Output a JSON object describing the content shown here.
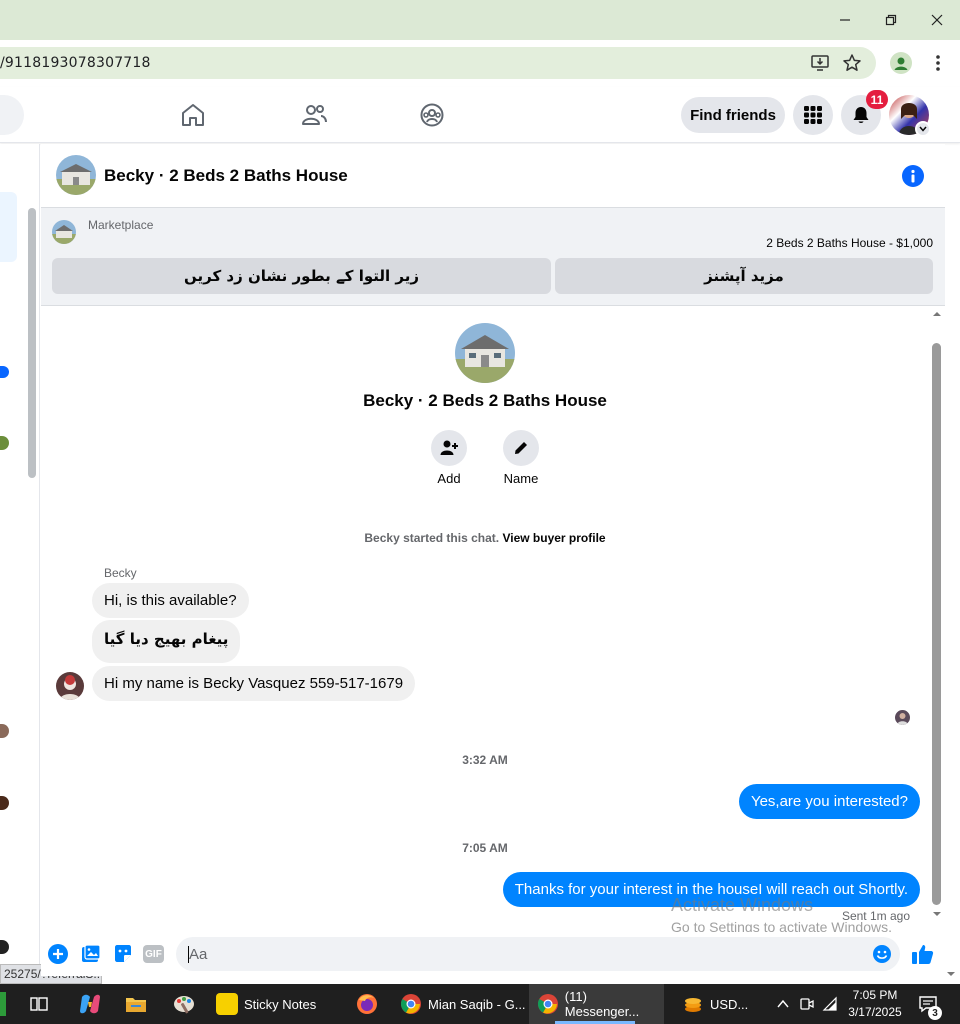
{
  "browser": {
    "url_fragment": "/9118193078307718",
    "status_url": "25275/?referralS..."
  },
  "header": {
    "find_friends_label": "Find friends",
    "notification_count": "11"
  },
  "chat": {
    "title": "Becky · 2 Beds 2 Baths House",
    "marketplace_label": "Marketplace",
    "listing": "2 Beds 2 Baths House - $1,000",
    "mark_sold_label": "زیر التوا کے بطور نشان زد کریں",
    "more_options_label": "مزید آپشنز",
    "profile_title": "Becky · 2 Beds 2 Baths House",
    "add_label": "Add",
    "name_label": "Name",
    "started_text": "Becky started this chat.",
    "view_profile_link": "View buyer profile",
    "sender_name": "Becky",
    "messages_in": [
      "Hi, is this available?",
      "پیغام بھیج دیا گیا",
      "Hi my name is Becky Vasquez 559-517-1679"
    ],
    "time1": "3:32 AM",
    "out1": "Yes,are you interested?",
    "time2": "7:05 AM",
    "out2": "Thanks for your interest in the houseI will reach out Shortly.",
    "sent_status": "Sent 1m ago",
    "composer_placeholder": "Aa"
  },
  "watermark": {
    "line1": "Activate Windows",
    "line2": "Go to Settings to activate Windows."
  },
  "taskbar": {
    "sticky_notes": "Sticky Notes",
    "chrome1": "Mian Saqib - G...",
    "chrome2": "(11) Messenger...",
    "stock": "USD...",
    "time": "7:05 PM",
    "date": "3/17/2025",
    "notif_count": "3"
  },
  "colors": {
    "messenger_blue": "#0084ff",
    "fb_blue": "#0866ff",
    "badge_red": "#e41e3f"
  }
}
